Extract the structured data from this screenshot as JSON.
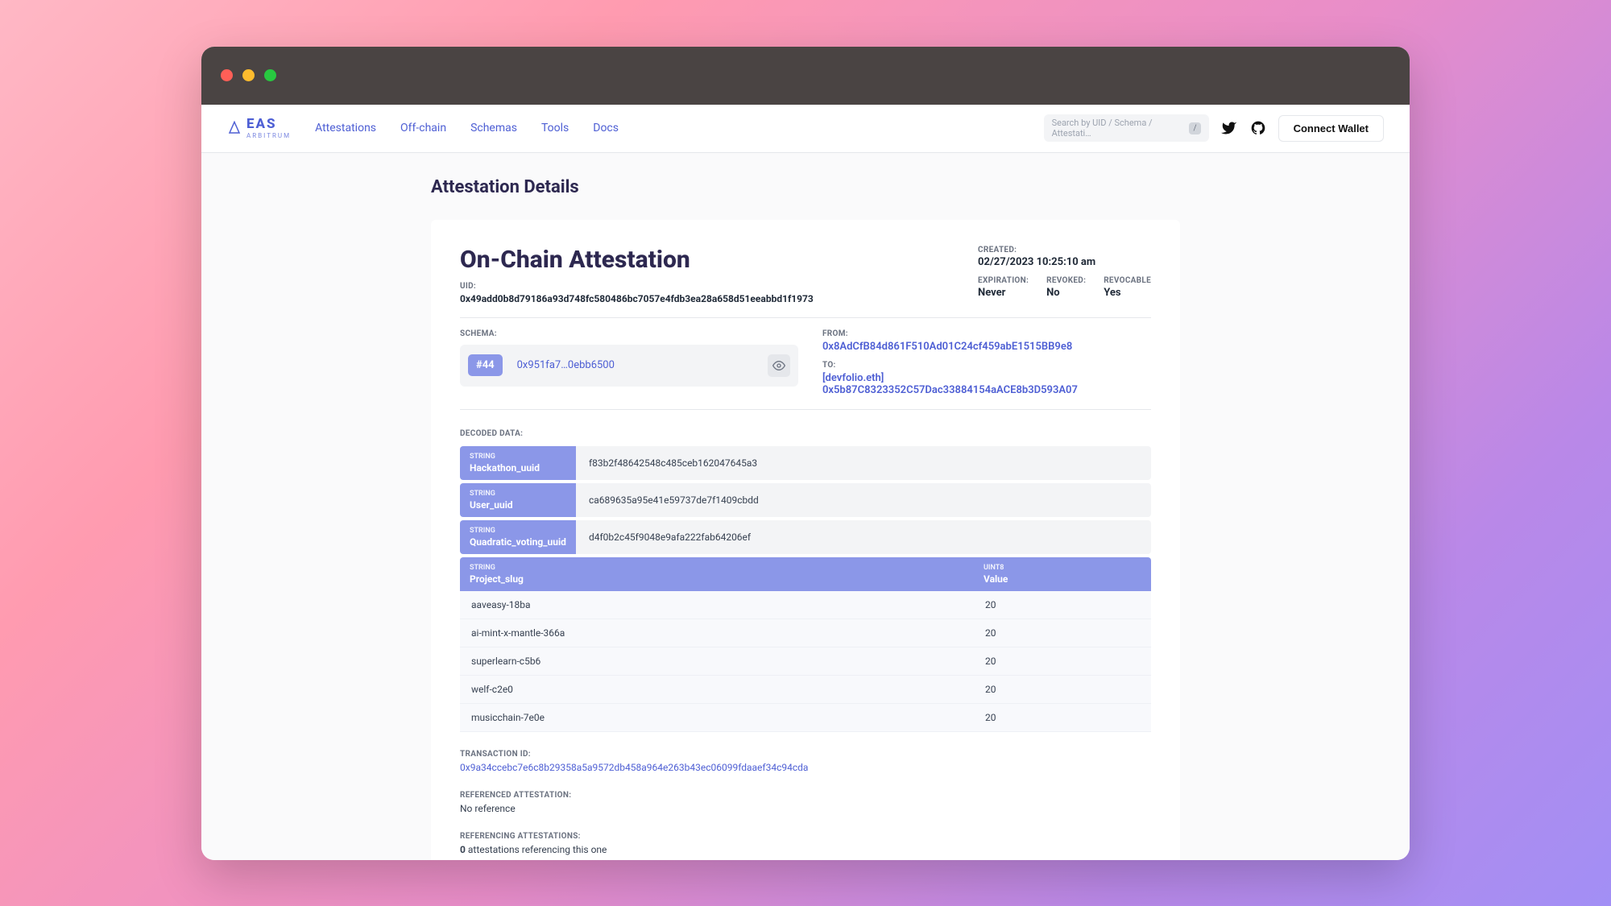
{
  "logo": {
    "main": "EAS",
    "sub": "ARBITRUM"
  },
  "nav": {
    "attestations": "Attestations",
    "offchain": "Off-chain",
    "schemas": "Schemas",
    "tools": "Tools",
    "docs": "Docs"
  },
  "search": {
    "placeholder": "Search by UID / Schema / Attestati…",
    "kbd": "/"
  },
  "connect": "Connect Wallet",
  "page_title": "Attestation Details",
  "title": "On-Chain Attestation",
  "uid_label": "UID:",
  "uid": "0x49add0b8d79186a93d748fc580486bc7057e4fdb3ea28a658d51eeabbd1f1973",
  "meta": {
    "created_label": "CREATED:",
    "created": "02/27/2023 10:25:10 am",
    "expiration_label": "EXPIRATION:",
    "expiration": "Never",
    "revoked_label": "REVOKED:",
    "revoked": "No",
    "revocable_label": "REVOCABLE",
    "revocable": "Yes"
  },
  "schema_label": "SCHEMA:",
  "schema": {
    "num": "#44",
    "addr": "0x951fa7…0ebb6500"
  },
  "from_label": "FROM:",
  "from": "0x8AdCfB84d861F510Ad01C24cf459abE1515BB9e8",
  "to_label": "TO:",
  "to_name": "[devfolio.eth]",
  "to_addr": "0x5b87C8323352C57Dac33884154aACE8b3D593A07",
  "decoded_label": "DECODED DATA:",
  "fields": [
    {
      "type": "STRING",
      "name": "Hackathon_uuid",
      "value": "f83b2f48642548c485ceb162047645a3"
    },
    {
      "type": "STRING",
      "name": "User_uuid",
      "value": "ca689635a95e41e59737de7f1409cbdd"
    },
    {
      "type": "STRING",
      "name": "Quadratic_voting_uuid",
      "value": "d4f0b2c45f9048e9afa222fab64206ef"
    }
  ],
  "proj_header": {
    "slug_type": "STRING",
    "slug_name": "Project_slug",
    "val_type": "UINT8",
    "val_name": "Value"
  },
  "projects": [
    {
      "slug": "aaveasy-18ba",
      "value": "20"
    },
    {
      "slug": "ai-mint-x-mantle-366a",
      "value": "20"
    },
    {
      "slug": "superlearn-c5b6",
      "value": "20"
    },
    {
      "slug": "welf-c2e0",
      "value": "20"
    },
    {
      "slug": "musicchain-7e0e",
      "value": "20"
    }
  ],
  "txid_label": "TRANSACTION ID:",
  "txid": "0x9a34ccebc7e6c8b29358a5a9572db458a964e263b43ec06099fdaaef34c94cda",
  "ref_label": "REFERENCED ATTESTATION:",
  "ref_value": "No reference",
  "refing_label": "REFERENCING ATTESTATIONS:",
  "refing_count": "0",
  "refing_suffix": " attestations referencing this one"
}
